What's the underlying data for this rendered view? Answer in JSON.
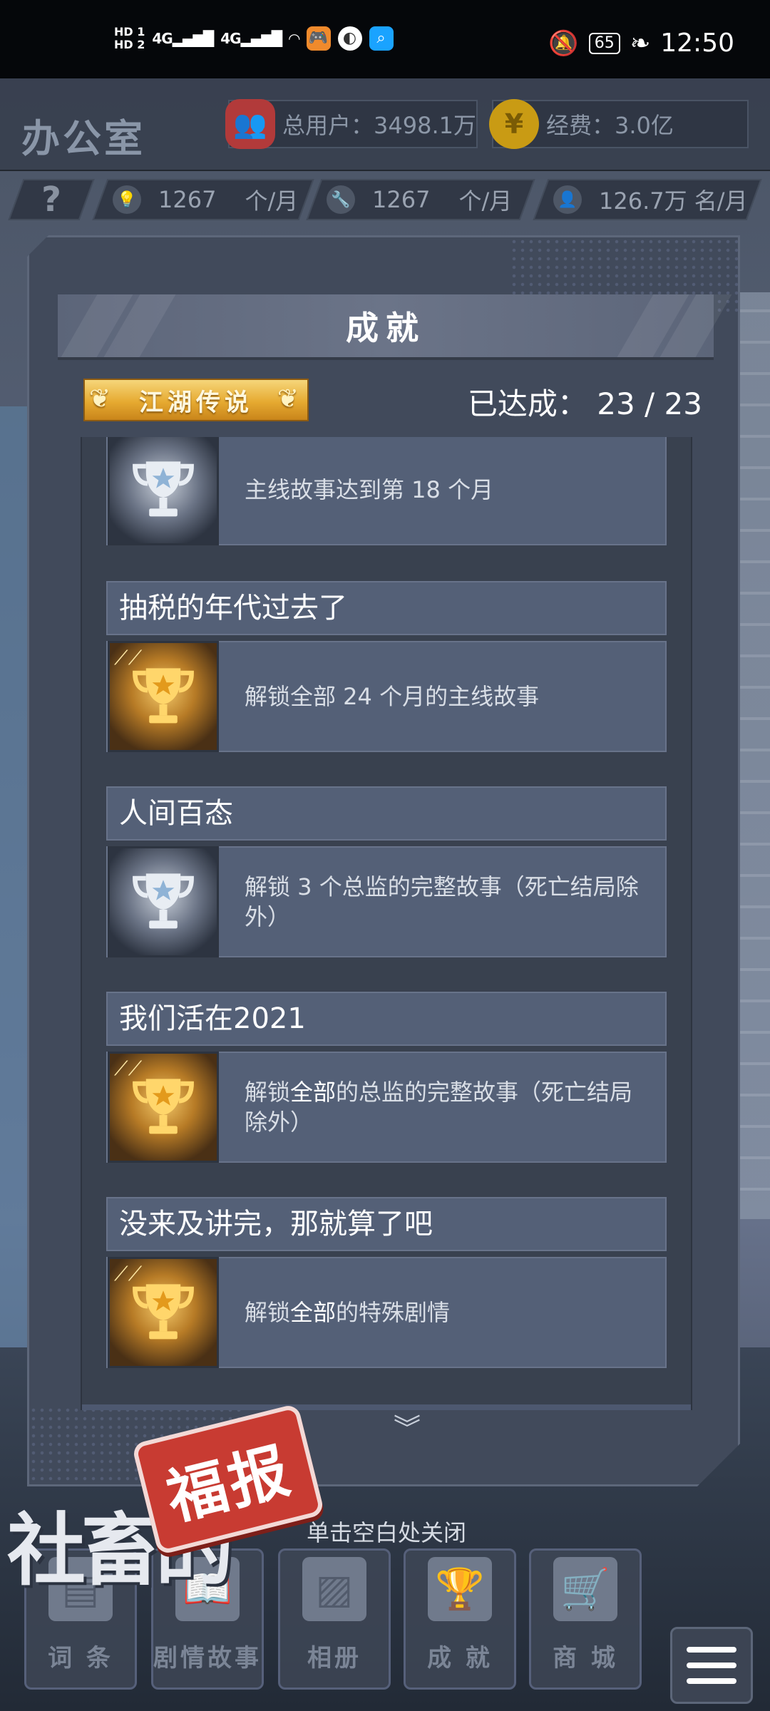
{
  "status_bar": {
    "hd1": "HD 1",
    "hd2": "HD 2",
    "net1": "4G",
    "net2": "4G",
    "battery": "65",
    "time": "12:50"
  },
  "hud": {
    "office": "办公室",
    "users": "总用户：3498.1万",
    "funds": "经费：3.0亿",
    "funds_icon_glyph": "¥",
    "help_glyph": "?",
    "res1": "1267",
    "res1_unit": "个/月",
    "res2": "1267",
    "res2_unit": "个/月",
    "res3": "126.7万 名/月"
  },
  "panel": {
    "title": "成就",
    "rank": "江湖传说",
    "progress": "已达成：  23 / 23",
    "scroll_glyph": "︾"
  },
  "achievements": [
    {
      "title": "",
      "desc": "主线故事达到第 18 个月",
      "trophy": "silver"
    },
    {
      "title": "抽税的年代过去了",
      "desc": "解锁全部 24 个月的主线故事",
      "trophy": "gold"
    },
    {
      "title": "人间百态",
      "desc": "解锁 3 个总监的完整故事（死亡结局除外）",
      "trophy": "silver"
    },
    {
      "title": "我们活在2021",
      "desc_pre": "解锁",
      "desc_hl": "全部",
      "desc_post": "的总监的完整故事（死亡结局除外）",
      "trophy": "gold"
    },
    {
      "title": "没来及讲完，那就算了吧",
      "desc_pre": "解锁",
      "desc_hl": "全部",
      "desc_post": "的特殊剧情",
      "trophy": "gold"
    }
  ],
  "close_hint": "单击空白处关闭",
  "logo": {
    "she": "社畜的",
    "stamp": "福报"
  },
  "nav": {
    "ci": "词 条",
    "story": "剧情故事",
    "album": "相册",
    "achieve": "成 就",
    "shop": "商 城"
  },
  "colors": {
    "gold": "#e6aa31",
    "panel": "#414a5b",
    "card": "#546077",
    "stamp": "#c83b32"
  }
}
